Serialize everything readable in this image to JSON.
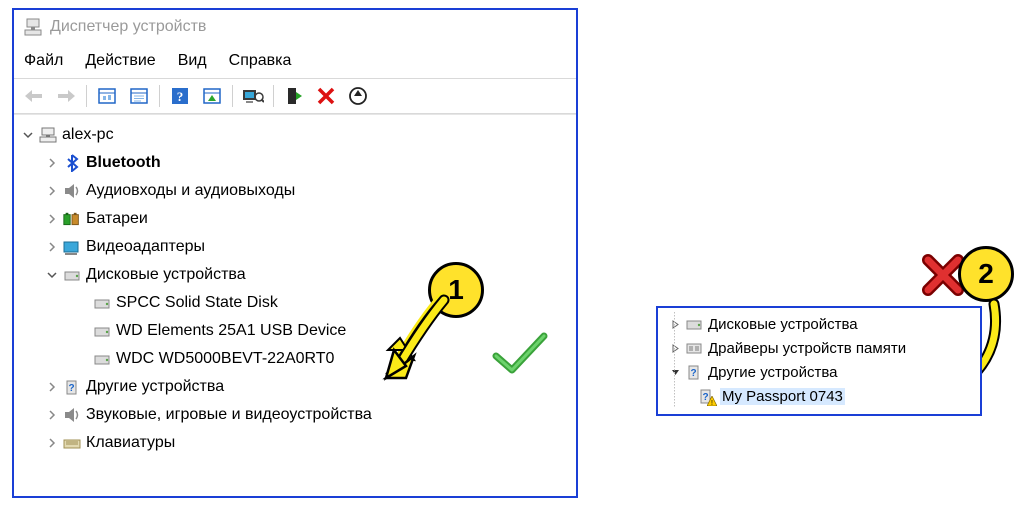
{
  "window": {
    "title": "Диспетчер устройств"
  },
  "menu": {
    "file": "Файл",
    "action": "Действие",
    "view": "Вид",
    "help": "Справка"
  },
  "root": "alex-pc",
  "cats": {
    "bluetooth": "Bluetooth",
    "audio": "Аудиовходы и аудиовыходы",
    "batteries": "Батареи",
    "display": "Видеоадаптеры",
    "disks": "Дисковые устройства",
    "other": "Другие устройства",
    "sound": "Звуковые, игровые и видеоустройства",
    "keyboards": "Клавиатуры"
  },
  "disk_items": {
    "spcc": "SPCC Solid State Disk",
    "wd_elements": "WD Elements 25A1 USB Device",
    "wdc": "WDC WD5000BEVT-22A0RT0"
  },
  "panel2": {
    "disks": "Дисковые устройства",
    "memdrv": "Драйверы устройств памяти",
    "other": "Другие устройства",
    "passport": "My Passport 0743"
  },
  "badges": {
    "one": "1",
    "two": "2"
  }
}
